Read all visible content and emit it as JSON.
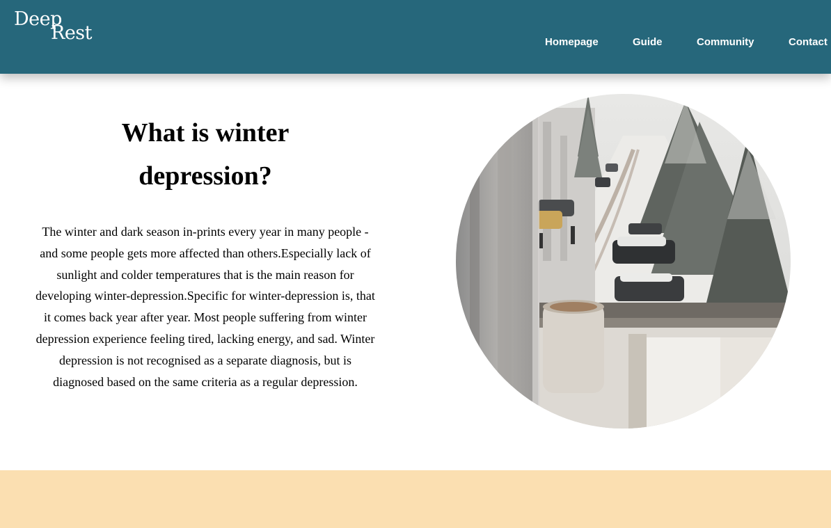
{
  "logo": {
    "word1": "Deep",
    "word2": "Rest"
  },
  "nav": {
    "items": [
      {
        "label": "Homepage"
      },
      {
        "label": "Guide"
      },
      {
        "label": "Community"
      },
      {
        "label": "Contact"
      }
    ]
  },
  "article": {
    "title": "What is winter depression?",
    "body": "The winter and dark season in-prints every year in many people - and some people gets more affected than others.Especially lack of sunlight and colder temperatures that is the main reason for developing winter-depression.Specific for winter-depression is, that it comes back year after year. Most people suffering from winter depression experience feeling tired, lacking energy, and sad. Winter depression is not recognised as a separate diagnosis, but is diagnosed based on the same criteria as a regular depression."
  },
  "colors": {
    "header": "#26677b",
    "footer_band": "#fbdfb1",
    "nav_text": "#ffffff"
  }
}
